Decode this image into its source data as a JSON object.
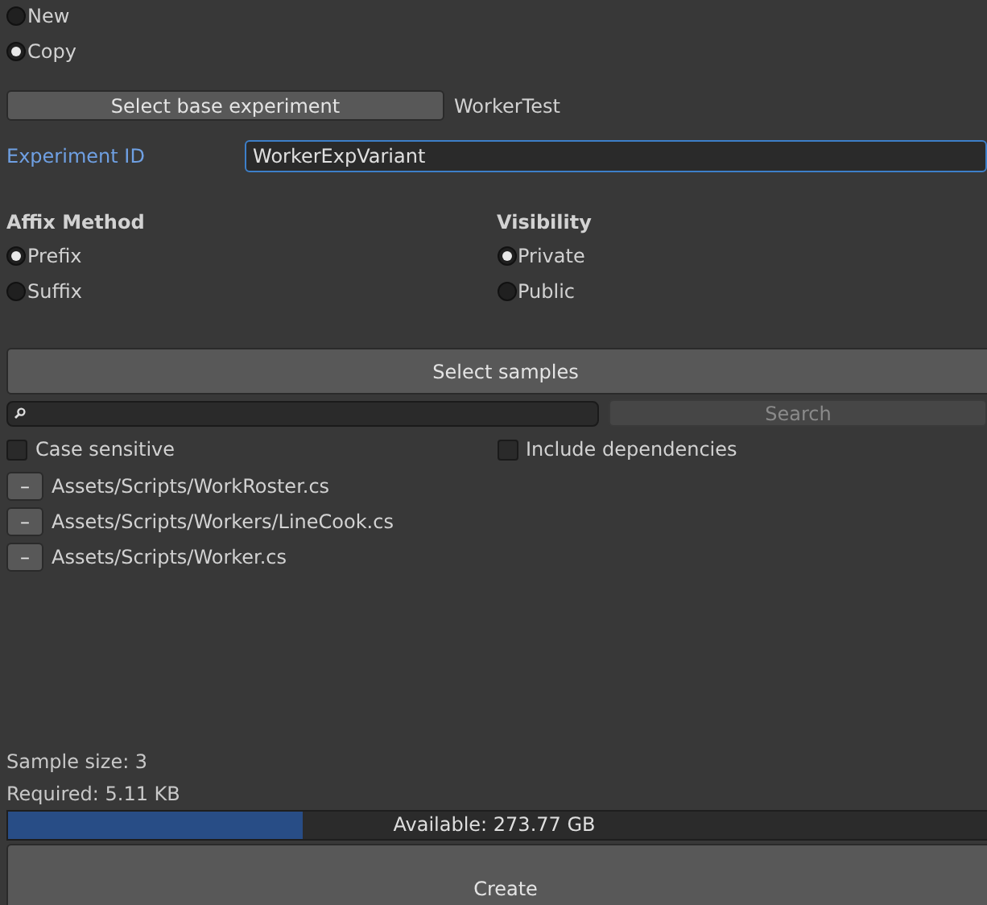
{
  "mode": [
    {
      "label": "New",
      "selected": false
    },
    {
      "label": "Copy",
      "selected": true
    }
  ],
  "base": {
    "button": "Select base experiment",
    "value": "WorkerTest"
  },
  "experiment_id": {
    "label": "Experiment ID",
    "value": "WorkerExpVariant"
  },
  "groups": [
    {
      "title": "Affix Method",
      "options": [
        {
          "label": "Prefix",
          "selected": true
        },
        {
          "label": "Suffix",
          "selected": false
        }
      ]
    },
    {
      "title": "Visibility",
      "options": [
        {
          "label": "Private",
          "selected": true
        },
        {
          "label": "Public",
          "selected": false
        }
      ]
    }
  ],
  "select_samples": "Select samples",
  "search": {
    "button": "Search",
    "disabled": true
  },
  "filters": [
    {
      "label": "Case sensitive",
      "checked": false
    },
    {
      "label": "Include dependencies",
      "checked": false
    }
  ],
  "samples": [
    {
      "remove": "–",
      "path": "Assets/Scripts/WorkRoster.cs"
    },
    {
      "remove": "–",
      "path": "Assets/Scripts/Workers/LineCook.cs"
    },
    {
      "remove": "–",
      "path": "Assets/Scripts/Worker.cs"
    }
  ],
  "sample_size": "Sample size: 3",
  "required": "Required: 5.11 KB",
  "storage": {
    "level": 0.3,
    "reading": "Available: 273.77 GB"
  },
  "create": "Create"
}
